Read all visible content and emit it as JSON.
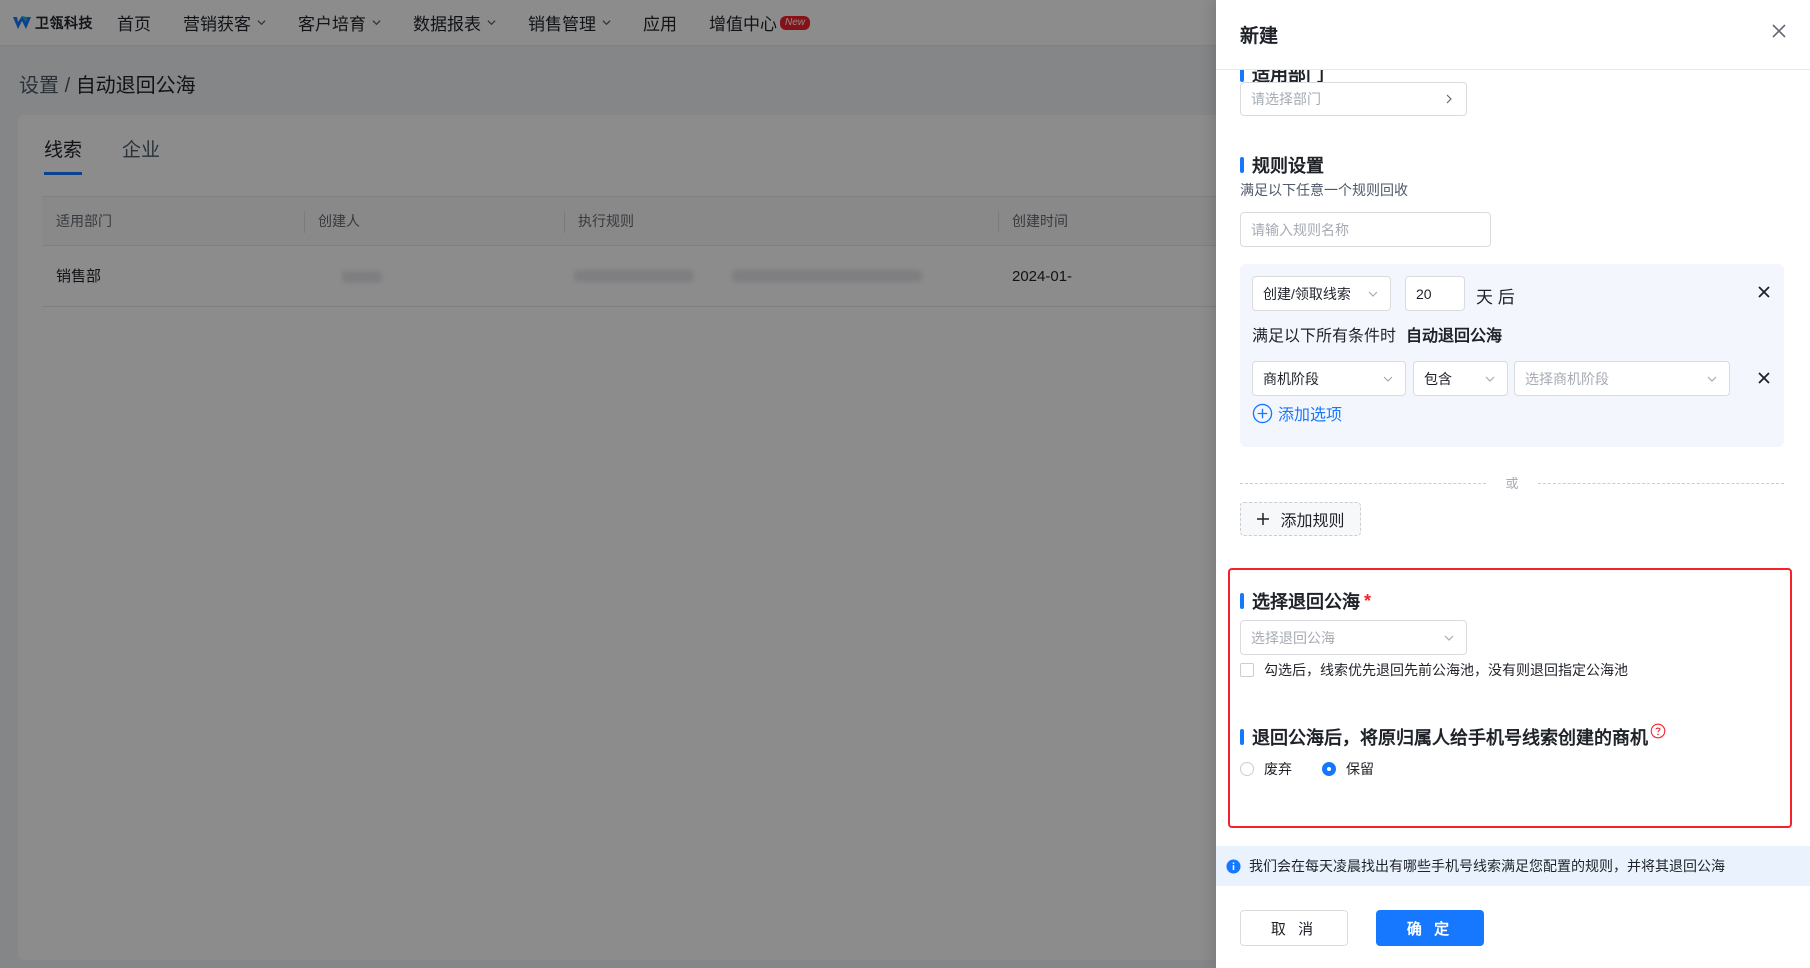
{
  "app": {
    "logo_text": "卫瓴科技"
  },
  "nav": [
    {
      "label": "首页",
      "has_dropdown": false
    },
    {
      "label": "营销获客",
      "has_dropdown": true
    },
    {
      "label": "客户培育",
      "has_dropdown": true
    },
    {
      "label": "数据报表",
      "has_dropdown": true
    },
    {
      "label": "销售管理",
      "has_dropdown": true
    },
    {
      "label": "应用",
      "has_dropdown": false
    },
    {
      "label": "增值中心",
      "has_dropdown": false,
      "badge": "New"
    }
  ],
  "breadcrumb": {
    "parent": "设置",
    "separator": "/",
    "current": "自动退回公海"
  },
  "tabs": [
    {
      "label": "线索",
      "active": true
    },
    {
      "label": "企业",
      "active": false
    }
  ],
  "table": {
    "columns": [
      "适用部门",
      "创建人",
      "执行规则",
      "创建时间"
    ],
    "rows": [
      {
        "dept": "销售部",
        "creator": "",
        "rule": "",
        "created": "2024-01-"
      }
    ]
  },
  "drawer": {
    "title": "新建",
    "department": {
      "partial_title": "适用部门",
      "placeholder": "请选择部门"
    },
    "rules": {
      "title": "规则设置",
      "hint": "满足以下任意一个规则回收",
      "name_placeholder": "请输入规则名称",
      "trigger_select": "创建/领取线索",
      "days": "20",
      "days_unit": "天 后",
      "condition_prefix": "满足以下所有条件时",
      "condition_action": "自动退回公海",
      "condition": {
        "field": "商机阶段",
        "operator": "包含",
        "value_placeholder": "选择商机阶段"
      },
      "add_option": "添加选项",
      "or_label": "或",
      "add_rule": "添加规则"
    },
    "pool": {
      "title": "选择退回公海",
      "required_mark": "*",
      "placeholder": "选择退回公海",
      "checkbox_label": "勾选后，线索优先退回先前公海池，没有则退回指定公海池",
      "checkbox_checked": false
    },
    "opportunity": {
      "title": "退回公海后，将原归属人给手机号线索创建的商机",
      "options": [
        {
          "label": "废弃",
          "checked": false
        },
        {
          "label": "保留",
          "checked": true
        }
      ]
    },
    "info": "我们会在每天凌晨找出有哪些手机号线索满足您配置的规则，并将其退回公海",
    "cancel": "取 消",
    "confirm": "确 定"
  },
  "colors": {
    "primary": "#1677ff",
    "danger": "#f5222d",
    "overlay": "rgba(0,0,0,0.45)"
  }
}
